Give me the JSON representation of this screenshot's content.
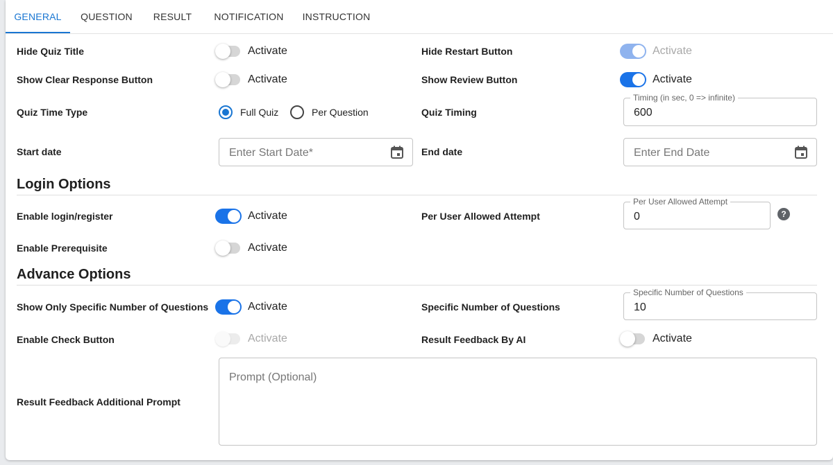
{
  "tabs": [
    {
      "label": "GENERAL",
      "active": true
    },
    {
      "label": "QUESTION",
      "active": false
    },
    {
      "label": "RESULT",
      "active": false
    },
    {
      "label": "NOTIFICATION",
      "active": false
    },
    {
      "label": "INSTRUCTION",
      "active": false
    }
  ],
  "colors": {
    "accent": "#1976d2",
    "switch_on": "#1a73e8",
    "switch_on_disabled": "#8fb3ee"
  },
  "switch_text": "Activate",
  "general": {
    "hide_quiz_title": {
      "label": "Hide Quiz Title",
      "on": false,
      "disabled": false
    },
    "hide_restart_button": {
      "label": "Hide Restart Button",
      "on": true,
      "disabled": true
    },
    "show_clear_response_button": {
      "label": "Show Clear Response Button",
      "on": false,
      "disabled": false
    },
    "show_review_button": {
      "label": "Show Review Button",
      "on": true,
      "disabled": false
    },
    "quiz_time_type": {
      "label": "Quiz Time Type",
      "options": [
        "Full Quiz",
        "Per Question"
      ],
      "selected": "Full Quiz"
    },
    "quiz_timing": {
      "label": "Quiz Timing",
      "field_label": "Timing (in sec, 0 => infinite)",
      "value": "600"
    },
    "start_date": {
      "label": "Start date",
      "placeholder": "Enter Start Date*"
    },
    "end_date": {
      "label": "End date",
      "placeholder": "Enter End Date"
    }
  },
  "login_options": {
    "title": "Login Options",
    "enable_login_register": {
      "label": "Enable login/register",
      "on": true,
      "disabled": false
    },
    "per_user_allowed_attempt": {
      "label": "Per User Allowed Attempt",
      "field_label": "Per User Allowed Attempt",
      "value": "0",
      "help_icon": "question-circle-icon"
    },
    "enable_prerequisite": {
      "label": "Enable Prerequisite",
      "on": false,
      "disabled": false
    }
  },
  "advance_options": {
    "title": "Advance Options",
    "show_only_specific_number": {
      "label": "Show Only Specific Number of Questions",
      "on": true,
      "disabled": false
    },
    "specific_number_of_questions": {
      "label": "Specific Number of Questions",
      "field_label": "Specific Number of Questions",
      "value": "10"
    },
    "enable_check_button": {
      "label": "Enable Check Button",
      "on": false,
      "disabled": true
    },
    "result_feedback_by_ai": {
      "label": "Result Feedback By AI",
      "on": false,
      "disabled": false
    },
    "additional_prompt": {
      "label": "Result Feedback Additional Prompt",
      "placeholder": "Prompt (Optional)"
    }
  }
}
